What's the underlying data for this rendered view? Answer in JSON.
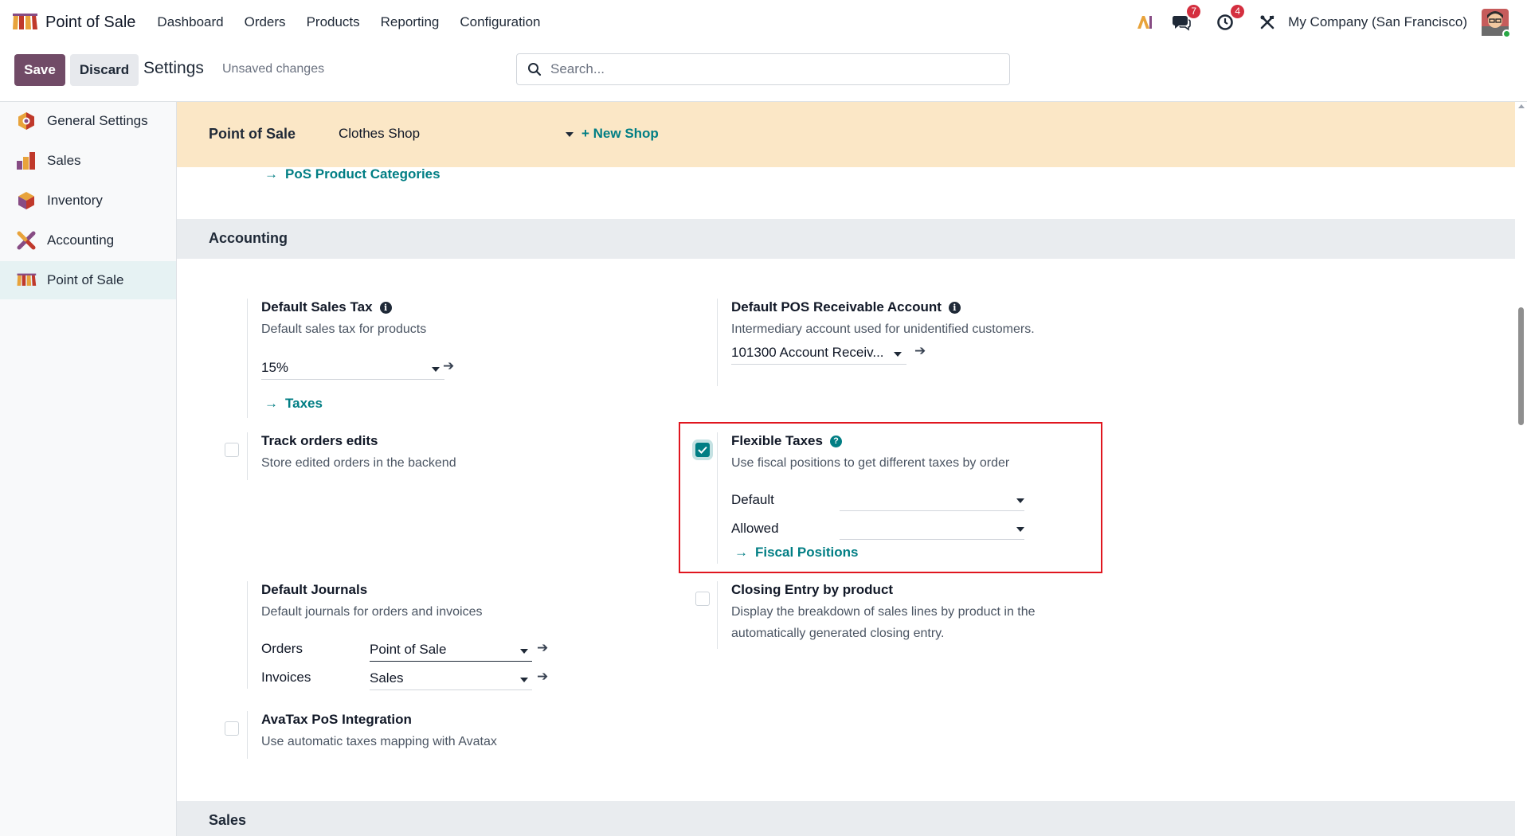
{
  "navbar": {
    "app_name": "Point of Sale",
    "menu": [
      "Dashboard",
      "Orders",
      "Products",
      "Reporting",
      "Configuration"
    ],
    "messages_count": "7",
    "activities_count": "4",
    "company": "My Company (San Francisco)"
  },
  "control_panel": {
    "save_label": "Save",
    "discard_label": "Discard",
    "title": "Settings",
    "status": "Unsaved changes",
    "search_placeholder": "Search..."
  },
  "sidebar": {
    "items": [
      {
        "label": "General Settings",
        "icon": "odoo-settings-icon"
      },
      {
        "label": "Sales",
        "icon": "sales-chart-icon"
      },
      {
        "label": "Inventory",
        "icon": "inventory-box-icon"
      },
      {
        "label": "Accounting",
        "icon": "accounting-icon"
      },
      {
        "label": "Point of Sale",
        "icon": "pos-shop-icon",
        "active": true
      }
    ]
  },
  "shop_bar": {
    "label": "Point of Sale",
    "selected_shop": "Clothes Shop",
    "new_shop_label": "+ New Shop"
  },
  "links": {
    "pos_categories": "PoS Product Categories",
    "taxes": "Taxes",
    "fiscal_positions": "Fiscal Positions"
  },
  "sections": {
    "accounting": "Accounting",
    "sales": "Sales"
  },
  "settings": {
    "default_sales_tax": {
      "title": "Default Sales Tax",
      "description": "Default sales tax for products",
      "value": "15%"
    },
    "default_receivable": {
      "title": "Default POS Receivable Account",
      "description": "Intermediary account used for unidentified customers.",
      "value": "101300 Account Receiv..."
    },
    "track_orders": {
      "title": "Track orders edits",
      "description": "Store edited orders in the backend",
      "checked": false
    },
    "flexible_taxes": {
      "title": "Flexible Taxes",
      "description": "Use fiscal positions to get different taxes by order",
      "checked": true,
      "default_label": "Default",
      "default_value": "",
      "allowed_label": "Allowed",
      "allowed_value": ""
    },
    "default_journals": {
      "title": "Default Journals",
      "description": "Default journals for orders and invoices",
      "orders_label": "Orders",
      "orders_value": "Point of Sale",
      "invoices_label": "Invoices",
      "invoices_value": "Sales"
    },
    "closing_entry": {
      "title": "Closing Entry by product",
      "description_line1": "Display the breakdown of sales lines by product in the",
      "description_line2": "automatically generated closing entry.",
      "checked": false
    },
    "avatax": {
      "title": "AvaTax PoS Integration",
      "description": "Use automatic taxes mapping with Avatax",
      "checked": false
    }
  },
  "colors": {
    "primary": "#714b67",
    "link": "#017e84",
    "shop_bar_bg": "#fbe7c6",
    "highlight": "#e0161f",
    "badge": "#d42f3f"
  }
}
